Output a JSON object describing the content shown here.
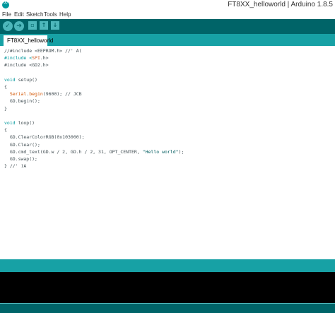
{
  "window": {
    "title": "FT8XX_helloworld | Arduino 1.8.5"
  },
  "menu": {
    "file": "File",
    "edit": "Edit",
    "sketch": "Sketch",
    "tools": "Tools",
    "help": "Help"
  },
  "toolbar": {
    "verify_glyph": "✓",
    "upload_glyph": "➔",
    "new_glyph": "▫",
    "open_glyph": "↑",
    "save_glyph": "↓"
  },
  "tab": {
    "label": "FT8XX_helloworld"
  },
  "code": {
    "l1": "//#include <EEPROM.h> //' A(",
    "l2a": "#include <",
    "l2b": "SPI",
    "l2c": ".h>",
    "l3": "#include <GD2.h>",
    "l5a": "void",
    "l5b": " setup()",
    "l6": "{",
    "l7a": "  ",
    "l7b": "Serial",
    "l7c": ".",
    "l7d": "begin",
    "l7e": "(9600); // JCB",
    "l8": "  GD.begin();",
    "l9": "}",
    "l11a": "void",
    "l11b": " loop()",
    "l12": "{",
    "l13": "  GD.ClearColorRGB(0x103000);",
    "l14": "  GD.Clear();",
    "l15a": "  GD.cmd_text(GD.w / 2, GD.h / 2, 31, OPT_CENTER, ",
    "l15b": "\"Hello world\"",
    "l15c": ");",
    "l16": "  GD.swap();",
    "l17": "} //' )A"
  },
  "colors": {
    "toolbar": "#006468",
    "tabbar": "#17a1a5",
    "button": "#4db7bb",
    "keyword": "#00979c",
    "console": "#000000"
  }
}
